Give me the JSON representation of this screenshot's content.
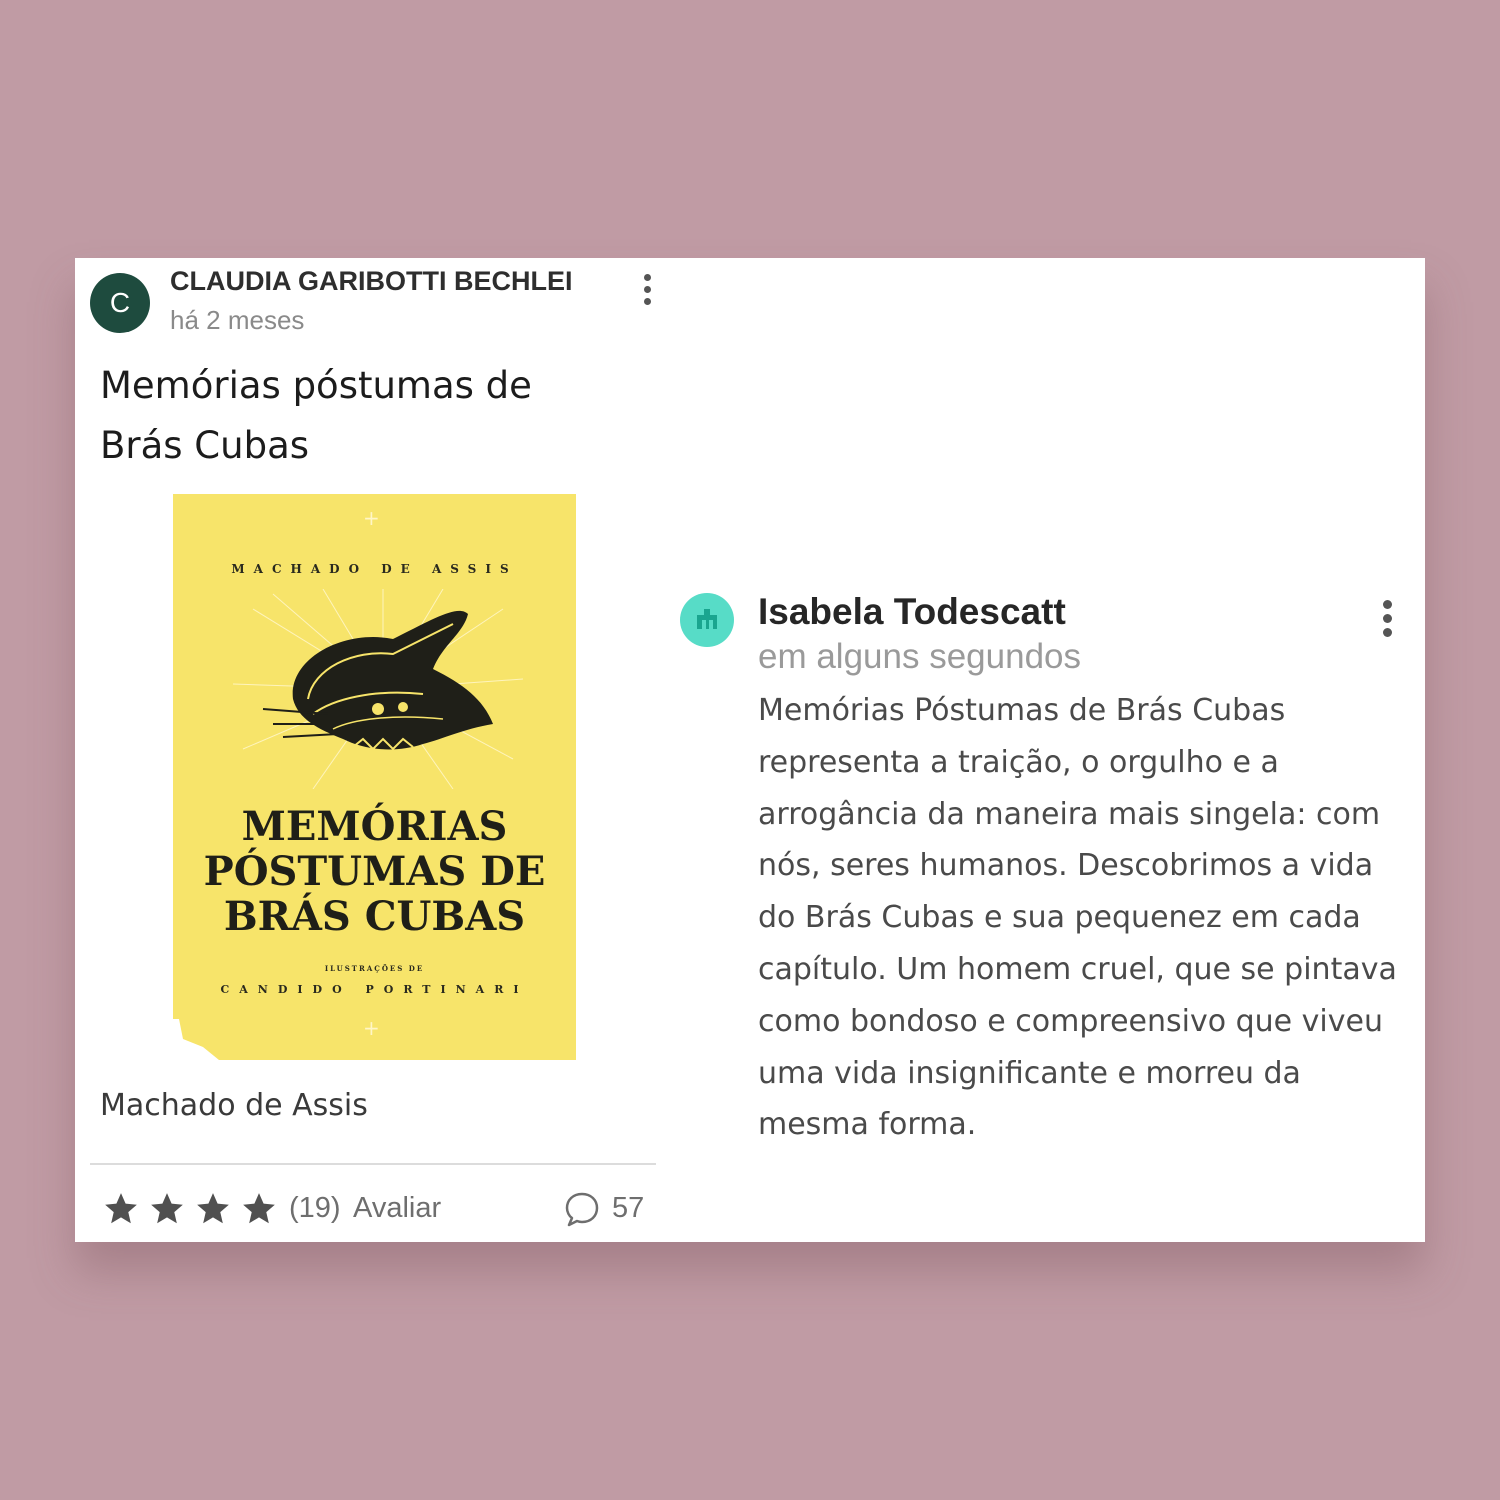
{
  "left_card": {
    "avatar_letter": "C",
    "user_name": "CLAUDIA GARIBOTTI BECHLEI",
    "time": "há 2 meses",
    "book_title": "Memórias póstumas de Brás Cubas",
    "cover": {
      "author": "MACHADO DE ASSIS",
      "title": "MEMÓRIAS\nPÓSTUMAS DE\nBRÁS CUBAS",
      "illustrations_label": "ILUSTRAÇÕES DE",
      "illustrator": "CANDIDO PORTINARI",
      "background_color": "#f7e46a"
    },
    "book_author": "Machado de Assis",
    "rating": {
      "stars_filled": 4,
      "count": "(19)",
      "rate_label": "Avaliar"
    },
    "comments": {
      "icon": "comment-icon",
      "count": "57"
    },
    "avatar_color": "#1e4b3e"
  },
  "right_card": {
    "user_name": "Isabela Todescatt",
    "time": "em alguns segundos",
    "review": "Memórias Póstumas de Brás Cubas representa a traição, o orgulho e a arrogância da maneira mais singela: com nós, seres humanos. Descobrimos a vida do Brás Cubas e sua pequenez em cada capítulo. Um homem cruel, que se pintava como bondoso e compreensivo que viveu uma vida insignificante e morreu da mesma forma.",
    "avatar_color": "#57dcc7"
  },
  "background_color": "#c09ba4"
}
